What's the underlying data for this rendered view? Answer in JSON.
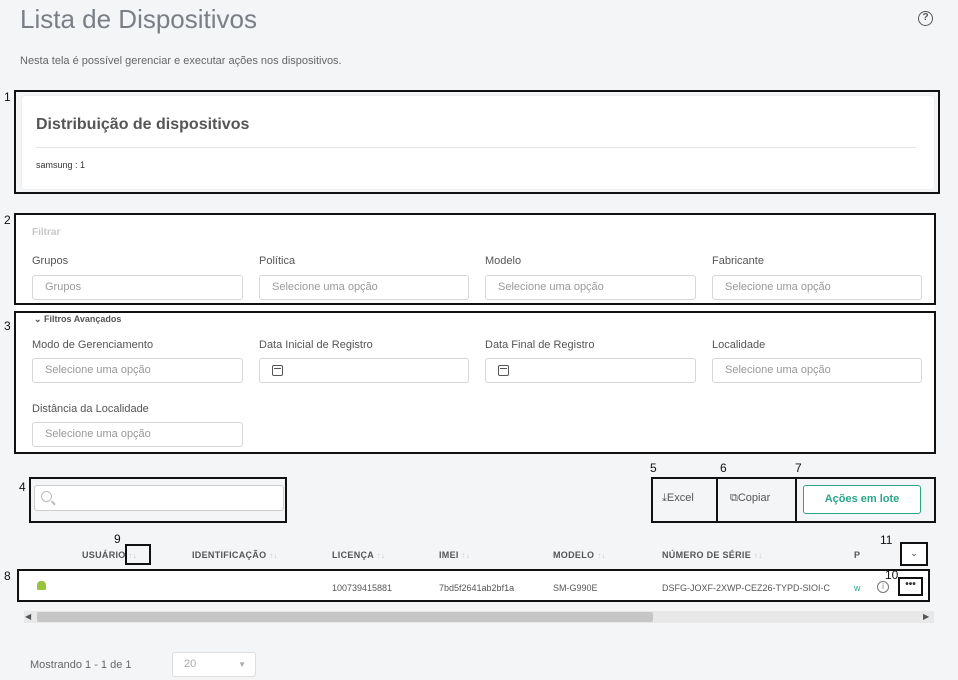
{
  "page": {
    "title": "Lista de Dispositivos",
    "subtitle": "Nesta tela é possível gerenciar e executar ações nos dispositivos.",
    "help_icon": "?"
  },
  "annotations": [
    "1",
    "2",
    "3",
    "4",
    "5",
    "6",
    "7",
    "8",
    "9",
    "10",
    "11"
  ],
  "distribution": {
    "title": "Distribuição de dispositivos",
    "item": "samsung : 1"
  },
  "filters": {
    "heading": "Filtrar",
    "groups_label": "Grupos",
    "groups_placeholder": "Grupos",
    "policy_label": "Política",
    "policy_placeholder": "Selecione uma opção",
    "model_label": "Modelo",
    "model_placeholder": "Selecione uma opção",
    "maker_label": "Fabricante",
    "maker_placeholder": "Selecione uma opção"
  },
  "advanced": {
    "toggle": "Filtros Avançados",
    "mode_label": "Modo de Gerenciamento",
    "mode_placeholder": "Selecione uma opção",
    "start_date_label": "Data Inicial de Registro",
    "end_date_label": "Data Final de Registro",
    "location_label": "Localidade",
    "location_placeholder": "Selecione uma opção",
    "distance_label": "Distância da Localidade",
    "distance_placeholder": "Selecione uma opção"
  },
  "toolbar": {
    "excel": "Excel",
    "copy": "Copiar",
    "bulk_actions": "Ações em lote"
  },
  "table": {
    "headers": [
      "USUÁRIO",
      "IDENTIFICAÇÃO",
      "LICENÇA",
      "IMEI",
      "MODELO",
      "NÚMERO DE SÉRIE",
      "P"
    ],
    "sort_glyph": "↑↓",
    "row": {
      "license": "100739415881",
      "imei": "7bd5f2641ab2bf1a",
      "model": "SM-G990E",
      "serial": "DSFG-JOXF-2XWP-CEZ26-TYPD-SIOI-C",
      "partial": "w"
    }
  },
  "footer": {
    "showing": "Mostrando 1 - 1 de 1",
    "page_size": "20"
  },
  "colors": {
    "accent": "#2aa58a",
    "android": "#97c43c"
  }
}
